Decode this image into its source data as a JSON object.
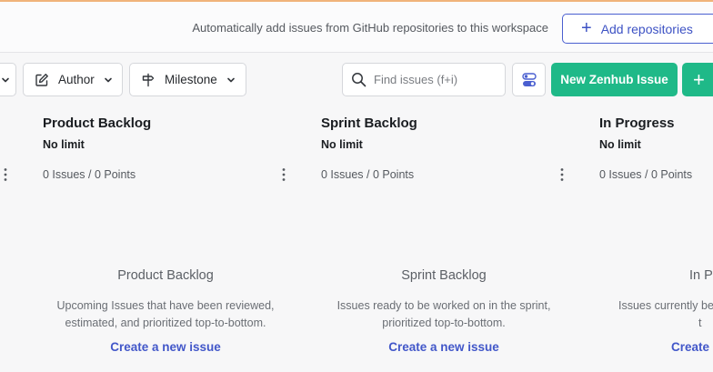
{
  "banner": {
    "text": "Automatically add issues from GitHub repositories to this workspace",
    "add_repositories_label": "Add repositories"
  },
  "toolbar": {
    "author_label": "Author",
    "milestone_label": "Milestone",
    "search_placeholder": "Find issues (f+i)",
    "new_issue_label": "New Zenhub Issue",
    "plus_label": "+"
  },
  "columns": [
    {
      "title": "Product Backlog",
      "limit": "No limit",
      "count": "0 Issues / 0 Points",
      "empty_title": "Product Backlog",
      "empty_desc_line1": "Upcoming Issues that have been reviewed,",
      "empty_desc_line2": "estimated, and prioritized top-to-bottom.",
      "create_label": "Create a new issue"
    },
    {
      "title": "Sprint Backlog",
      "limit": "No limit",
      "count": "0 Issues / 0 Points",
      "empty_title": "Sprint Backlog",
      "empty_desc_line1": "Issues ready to be worked on in the sprint,",
      "empty_desc_line2": "prioritized top-to-bottom.",
      "create_label": "Create a new issue"
    },
    {
      "title": "In Progress",
      "limit": "No limit",
      "count": "0 Issues / 0 Points",
      "empty_title": "In Pr",
      "empty_desc_line1": "Issues currently be",
      "empty_desc_line2": "t",
      "create_label": "Create"
    }
  ],
  "colors": {
    "accent_blue": "#3d52c4",
    "zenhub_green": "#1fb988",
    "banner_top_line": "#f0b37a"
  },
  "icons": {
    "author": "pencil-square-icon",
    "milestone": "signpost-icon",
    "search": "search-icon",
    "toggle": "toggle-switch-icon",
    "menu": "vertical-dots-icon",
    "chevron": "chevron-down-icon"
  }
}
